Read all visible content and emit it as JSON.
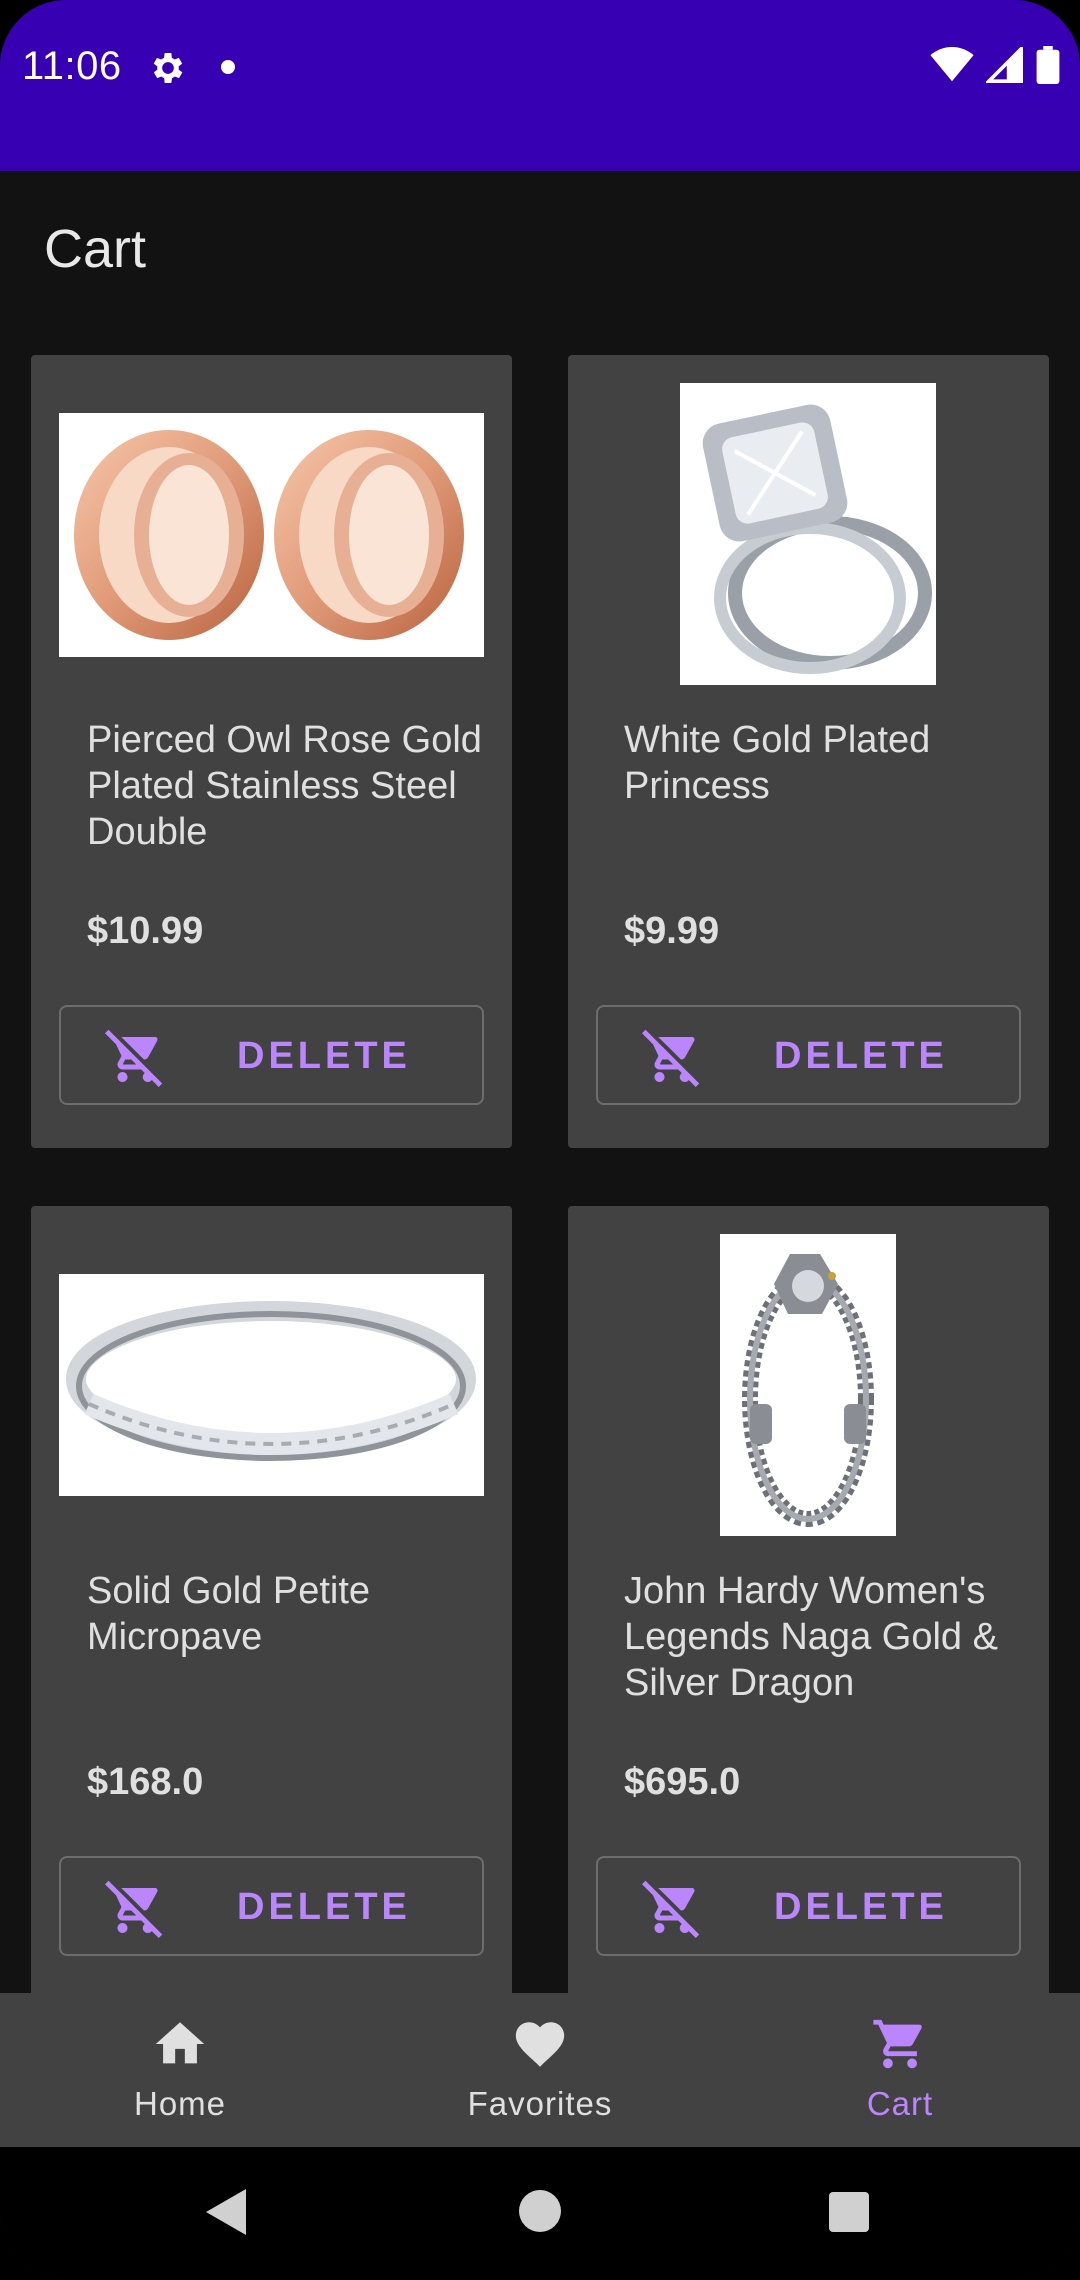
{
  "status_bar": {
    "time": "11:06",
    "icons": [
      "settings-icon",
      "notification-dot",
      "wifi-icon",
      "signal-icon",
      "battery-icon"
    ],
    "color": "#3700b3"
  },
  "page": {
    "title": "Cart"
  },
  "products": [
    {
      "name": "Pierced Owl Rose Gold Plated Stainless Steel Double",
      "price": "$10.99",
      "delete_label": "DELETE",
      "image": "rose-gold-plugs"
    },
    {
      "name": "White Gold Plated Princess",
      "price": "$9.99",
      "delete_label": "DELETE",
      "image": "diamond-ring-set"
    },
    {
      "name": "Solid Gold Petite Micropave",
      "price": "$168.0",
      "delete_label": "DELETE",
      "image": "silver-band-ring"
    },
    {
      "name": "John Hardy Women's Legends Naga Gold & Silver Dragon",
      "price": "$695.0",
      "delete_label": "DELETE",
      "image": "dragon-bracelet"
    }
  ],
  "bottom_nav": {
    "items": [
      {
        "label": "Home",
        "icon": "home-icon",
        "active": false
      },
      {
        "label": "Favorites",
        "icon": "heart-icon",
        "active": false
      },
      {
        "label": "Cart",
        "icon": "cart-icon",
        "active": true
      }
    ],
    "active_color": "#bb86fc",
    "inactive_color": "#e0e0e0"
  },
  "system_nav": {
    "buttons": [
      "back",
      "home",
      "recents"
    ]
  },
  "colors": {
    "accent": "#bb86fc",
    "card": "#424242",
    "background": "#121212"
  }
}
